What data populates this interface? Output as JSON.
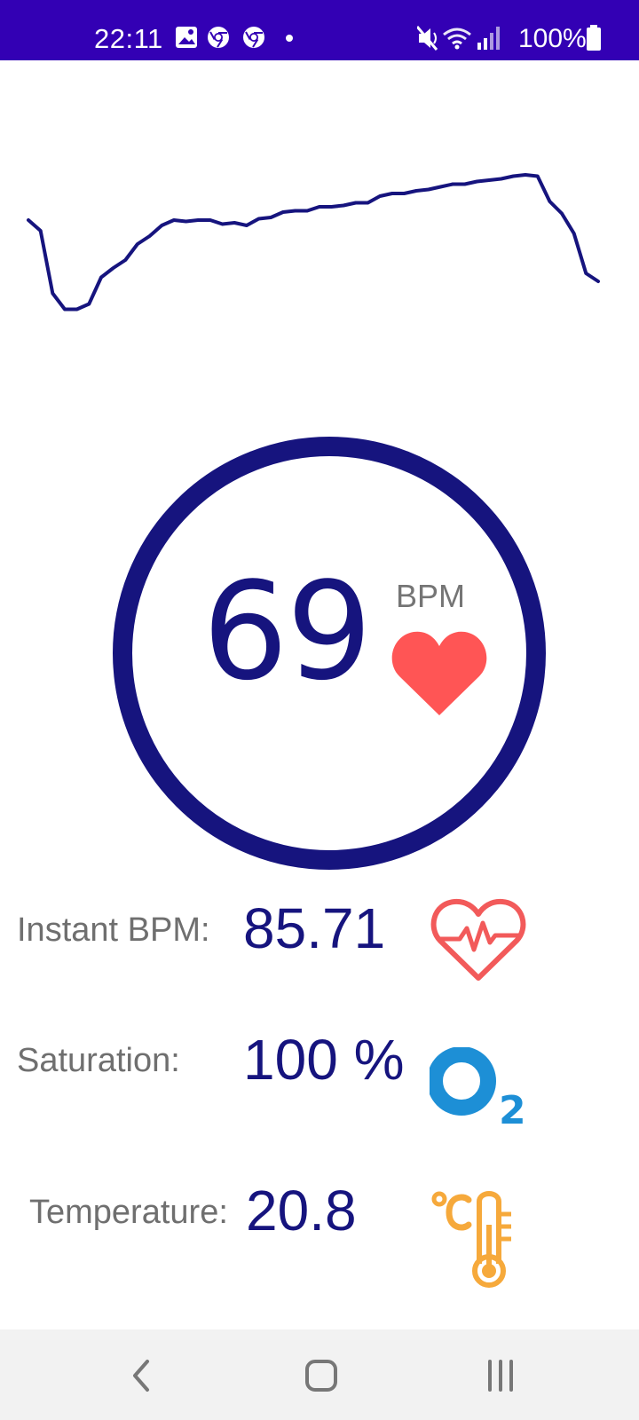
{
  "status_bar": {
    "time": "22:11",
    "battery": "100%",
    "background_color": "#3300b4",
    "left_icons": [
      "gallery-icon",
      "chrome-icon",
      "chrome-icon",
      "dot-icon"
    ],
    "right_icons": [
      "mute-icon",
      "wifi-icon",
      "signal-icon",
      "battery-icon"
    ]
  },
  "graph": {
    "type": "line",
    "color": "#16147e",
    "description_values": [
      0.88,
      0.8,
      0.33,
      0.21,
      0.21,
      0.25,
      0.45,
      0.52,
      0.58,
      0.7,
      0.76,
      0.84,
      0.88,
      0.87,
      0.88,
      0.88,
      0.85,
      0.86,
      0.84,
      0.89,
      0.9,
      0.94,
      0.95,
      0.95,
      0.98,
      0.98,
      0.99,
      1.01,
      1.01,
      1.06,
      1.08,
      1.08,
      1.1,
      1.11,
      1.13,
      1.15,
      1.15,
      1.17,
      1.18,
      1.19,
      1.21,
      1.22,
      1.21,
      1.02,
      0.93,
      0.78,
      0.48,
      0.42
    ]
  },
  "bpm": {
    "value": "69",
    "unit": "BPM",
    "ring_color": "#16147e",
    "heart_color": "#ff5555"
  },
  "metrics": {
    "instant_bpm": {
      "label": "Instant BPM:",
      "value": "85.71",
      "icon": "heartbeat-icon",
      "icon_color": "#f25a5a"
    },
    "saturation": {
      "label": "Saturation:",
      "value": "100 %",
      "icon": "oxygen-icon",
      "icon_color": "#1d8fd6"
    },
    "temperature": {
      "label": "Temperature:",
      "value": "20.8",
      "icon": "thermometer-icon",
      "icon_color": "#f6a93b"
    }
  },
  "nav_bar": {
    "buttons": [
      "back-icon",
      "home-icon",
      "recents-icon"
    ]
  }
}
